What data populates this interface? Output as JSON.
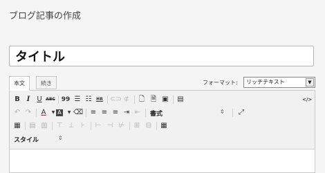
{
  "page": {
    "heading": "ブログ記事の作成"
  },
  "title_field": {
    "value": "タイトル"
  },
  "tabs": [
    {
      "label": "本文"
    },
    {
      "label": "続き"
    }
  ],
  "format": {
    "label": "フォーマット:",
    "selected": "リッチテキスト"
  },
  "toolbar": {
    "bold": "B",
    "italic": "I",
    "underline": "U",
    "strikethrough": "ABC",
    "blockquote": "99",
    "source": "</>",
    "format_block_label": "書式",
    "style_label": "スタイル"
  }
}
